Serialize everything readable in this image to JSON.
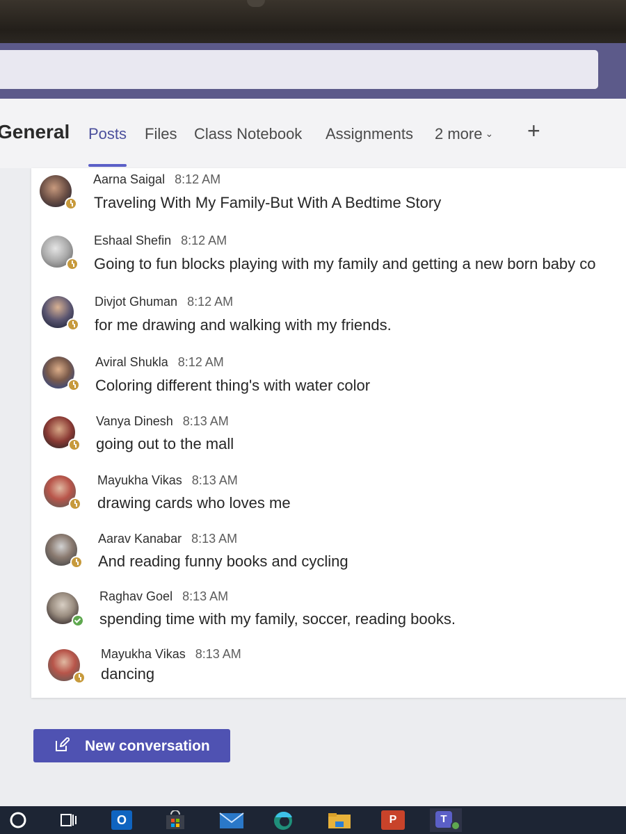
{
  "header": {
    "channel_title": "General",
    "tabs": [
      {
        "label": "Posts",
        "active": true
      },
      {
        "label": "Files"
      },
      {
        "label": "Class Notebook"
      },
      {
        "label": "Assignments"
      },
      {
        "label": "2 more"
      }
    ],
    "add_tab_label": "+"
  },
  "messages": [
    {
      "author": "Aarna Saigal",
      "time": "8:12 AM",
      "text": "Traveling With My Family-But With A Bedtime Story",
      "presence": "away"
    },
    {
      "author": "Eshaal Shefin",
      "time": "8:12 AM",
      "text": "Going to fun blocks playing with my family and getting a new born baby co",
      "presence": "away"
    },
    {
      "author": "Divjot Ghuman",
      "time": "8:12 AM",
      "text": "for me drawing and walking with my friends.",
      "presence": "away"
    },
    {
      "author": "Aviral Shukla",
      "time": "8:12 AM",
      "text": "Coloring different thing's with water color",
      "presence": "away"
    },
    {
      "author": "Vanya Dinesh",
      "time": "8:13 AM",
      "text": "going out to the mall",
      "presence": "away"
    },
    {
      "author": "Mayukha Vikas",
      "time": "8:13 AM",
      "text": "drawing cards who loves me",
      "presence": "away"
    },
    {
      "author": "Aarav Kanabar",
      "time": "8:13 AM",
      "text": "And reading funny books and cycling",
      "presence": "away"
    },
    {
      "author": "Raghav Goel",
      "time": "8:13 AM",
      "text": "spending time with my family, soccer, reading books.",
      "presence": "available"
    },
    {
      "author": "Mayukha Vikas",
      "time": "8:13 AM",
      "text": "dancing",
      "presence": "away"
    }
  ],
  "new_conversation_label": "New conversation",
  "colors": {
    "accent": "#5b5fc7",
    "button": "#4f52b2",
    "title_bar": "#5c5a8a",
    "presence_away": "#c79a3c",
    "presence_available": "#5fa84f"
  },
  "taskbar": {
    "icons": [
      "start-circle-icon",
      "task-view-icon",
      "outlook-icon",
      "store-icon",
      "mail-icon",
      "edge-icon",
      "file-explorer-icon",
      "powerpoint-icon",
      "teams-icon"
    ],
    "outlook_letter": "O",
    "powerpoint_letter": "P",
    "teams_letter": "T"
  }
}
